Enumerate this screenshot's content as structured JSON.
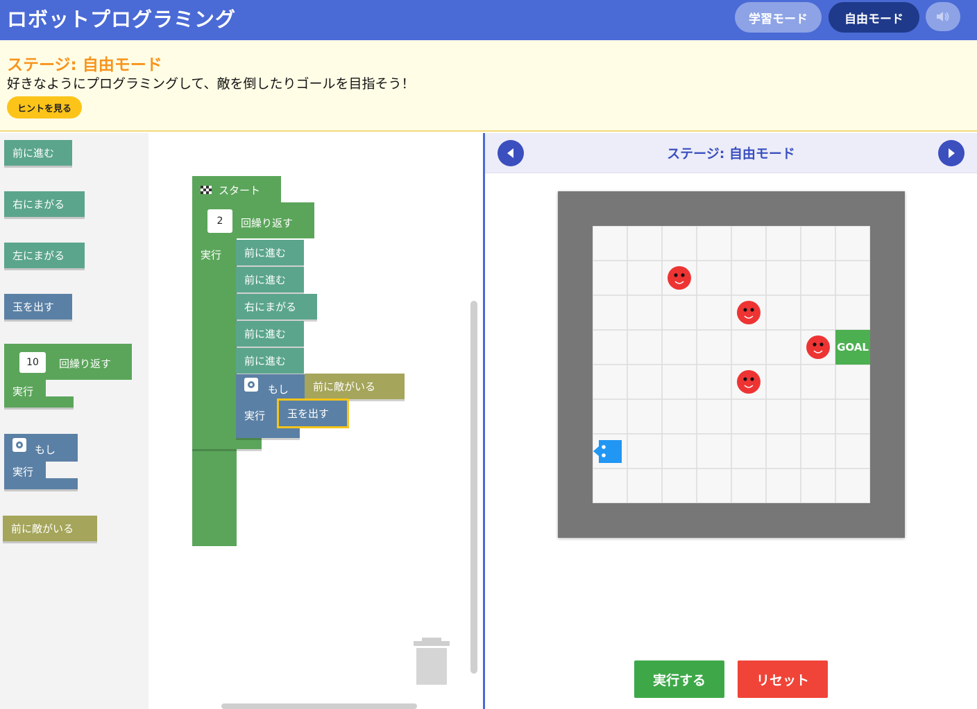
{
  "header": {
    "title": "ロボットプログラミング",
    "learn_mode": "学習モード",
    "free_mode": "自由モード",
    "sound_icon": "speaker-icon"
  },
  "info": {
    "stage_title": "ステージ: 自由モード",
    "description": "好きなようにプログラミングして、敵を倒したりゴールを目指そう！",
    "hint_button": "ヒントを見る"
  },
  "toolbox": {
    "forward": "前に進む",
    "turn_right": "右にまがる",
    "turn_left": "左にまがる",
    "shoot": "玉を出す",
    "repeat_count": "10",
    "repeat_label": "回繰り返す",
    "do_label": "実行",
    "if_label": "もし",
    "enemy_ahead": "前に敵がいる"
  },
  "workspace": {
    "start": "スタート",
    "repeat_count": "2",
    "repeat_label": "回繰り返す",
    "do_label": "実行",
    "steps": [
      "前に進む",
      "前に進む",
      "右にまがる",
      "前に進む",
      "前に進む"
    ],
    "if_label": "もし",
    "condition": "前に敵がいる",
    "then_action": "玉を出す"
  },
  "stage_panel": {
    "title": "ステージ: 自由モード",
    "goal_label": "GOAL",
    "grid_cols": 8,
    "grid_rows": 8,
    "enemies": [
      {
        "col": 2,
        "row": 1
      },
      {
        "col": 4,
        "row": 2
      },
      {
        "col": 6,
        "row": 3
      },
      {
        "col": 4,
        "row": 4
      }
    ],
    "goal": {
      "col": 7,
      "row": 3
    },
    "robot": {
      "col": 0,
      "row": 6,
      "facing": "left"
    }
  },
  "controls": {
    "run": "実行する",
    "reset": "リセット"
  },
  "colors": {
    "header": "#4a6ad6",
    "accent": "#f7941d",
    "move_block": "#5ba58c",
    "loop_block": "#5ba55b",
    "logic_block": "#5b80a5",
    "sensor_block": "#a5a55b",
    "run": "#3ea849",
    "reset": "#f04438",
    "enemy": "#ee3333",
    "goal": "#4caf50",
    "robot": "#2196f3"
  }
}
